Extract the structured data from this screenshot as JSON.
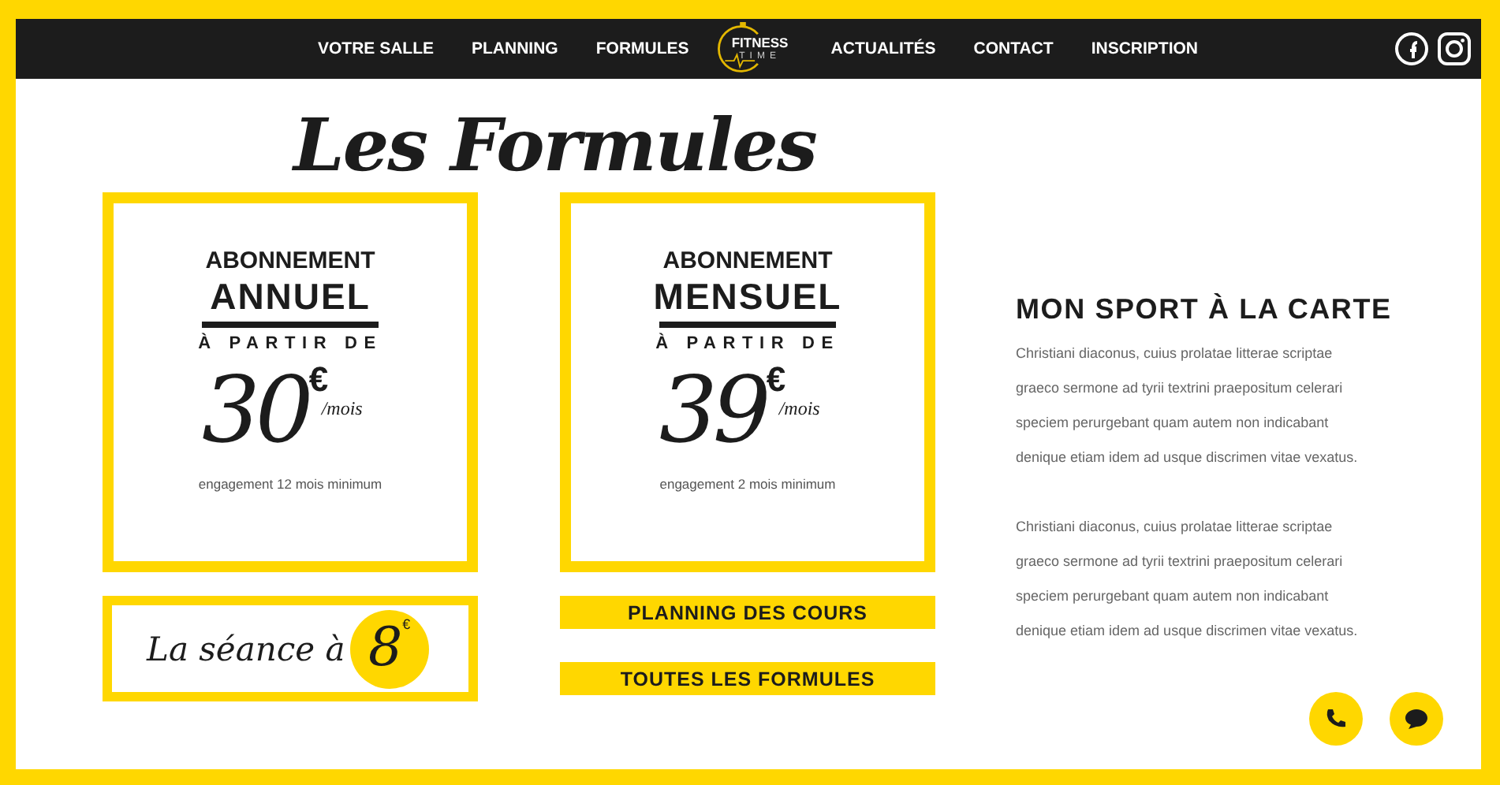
{
  "nav": {
    "left": [
      "VOTRE SALLE",
      "PLANNING",
      "FORMULES"
    ],
    "logo": {
      "top": "FITNESS",
      "bottom": "TIME"
    },
    "right": [
      "ACTUALITÉS",
      "CONTACT",
      "INSCRIPTION"
    ]
  },
  "title": "Les Formules",
  "plans": [
    {
      "line1": "ABONNEMENT",
      "line2": "ANNUEL",
      "from": "À PARTIR DE",
      "price": "30",
      "currency": "€",
      "period": "/mois",
      "note": "engagement 12 mois minimum"
    },
    {
      "line1": "ABONNEMENT",
      "line2": "MENSUEL",
      "from": "À PARTIR DE",
      "price": "39",
      "currency": "€",
      "period": "/mois",
      "note": "engagement 2 mois minimum"
    }
  ],
  "session": {
    "text": "La séance à",
    "price": "8",
    "currency": "€"
  },
  "buttons": [
    "PLANNING DES COURS",
    "TOUTES LES FORMULES"
  ],
  "aside": {
    "heading": "MON SPORT À LA CARTE",
    "paragraphs": [
      [
        "Christiani diaconus, cuius prolatae litterae scriptae",
        "graeco sermone ad tyrii textrini praepositum celerari",
        "speciem perurgebant quam autem non indicabant",
        "denique etiam idem ad usque discrimen vitae vexatus."
      ],
      [
        "Christiani diaconus, cuius prolatae litterae scriptae",
        "graeco sermone ad tyrii textrini praepositum celerari",
        "speciem perurgebant quam autem non indicabant",
        "denique etiam idem ad usque discrimen vitae vexatus."
      ]
    ]
  }
}
